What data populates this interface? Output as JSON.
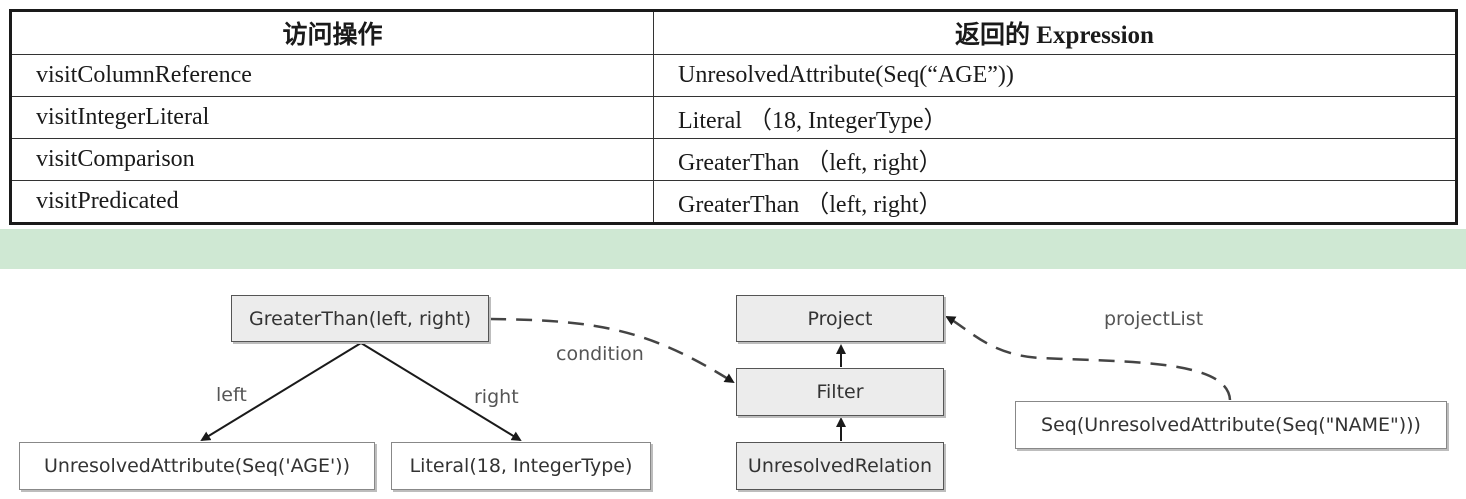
{
  "table": {
    "headers": [
      "访问操作",
      "返回的 Expression"
    ],
    "rows": [
      [
        "visitColumnReference",
        "UnresolvedAttribute(Seq(“AGE”))"
      ],
      [
        "visitIntegerLiteral",
        "Literal （18, IntegerType）"
      ],
      [
        "visitComparison",
        "GreaterThan （left, right）"
      ],
      [
        "visitPredicated",
        "GreaterThan （left, right）"
      ]
    ]
  },
  "diagram": {
    "nodes": {
      "greater_than": "GreaterThan(left, right)",
      "unresolved_attr_age": "UnresolvedAttribute(Seq('AGE'))",
      "literal": "Literal(18, IntegerType)",
      "project": "Project",
      "filter": "Filter",
      "unresolved_relation": "UnresolvedRelation",
      "seq_name": "Seq(UnresolvedAttribute(Seq(\"NAME\")))"
    },
    "edge_labels": {
      "left": "left",
      "right": "right",
      "condition": "condition",
      "project_list": "projectList"
    }
  },
  "colors": {
    "band": "#cfe8d3",
    "node_fill": "#ececec",
    "border": "#1a1a1a"
  }
}
